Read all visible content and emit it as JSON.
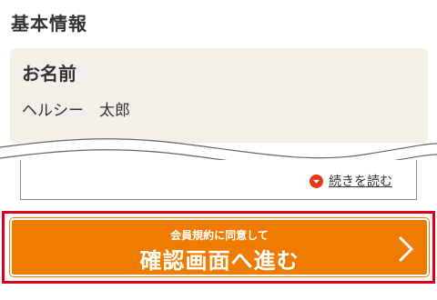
{
  "section": {
    "title": "基本情報"
  },
  "profile": {
    "name_label": "お名前",
    "name_value": "ヘルシー　太郎"
  },
  "terms": {
    "read_more_label": "続きを読む",
    "read_more_icon": "chevron-down-circle-icon"
  },
  "cta": {
    "sub_label": "会員規約に同意して",
    "main_label": "確認画面へ進む",
    "icon": "chevron-right-icon"
  },
  "colors": {
    "accent_orange": "#ef7b00",
    "highlight_red": "#e0001c",
    "card_background": "#f5efe9",
    "icon_red": "#e8381c"
  }
}
